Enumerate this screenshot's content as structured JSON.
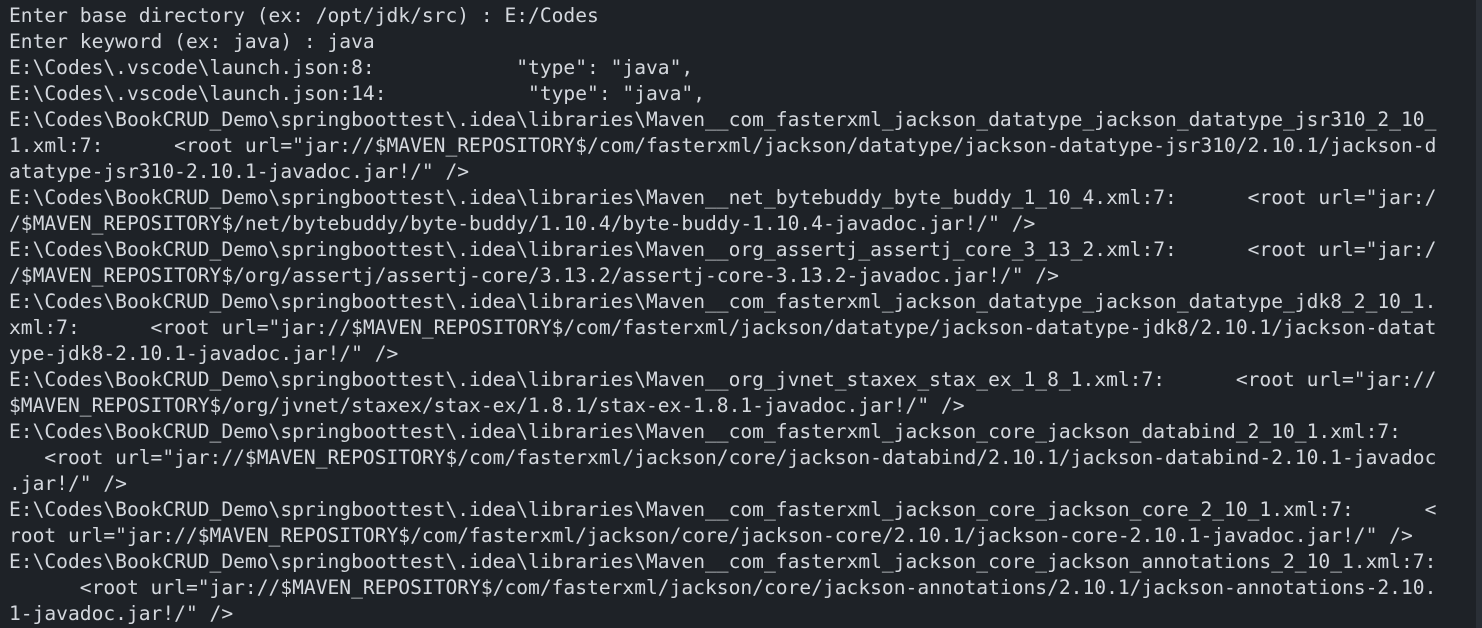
{
  "terminal": {
    "lines": [
      "Enter base directory (ex: /opt/jdk/src) : E:/Codes",
      "Enter keyword (ex: java) : java",
      "E:\\Codes\\.vscode\\launch.json:8:            \"type\": \"java\",",
      "E:\\Codes\\.vscode\\launch.json:14:            \"type\": \"java\",",
      "E:\\Codes\\BookCRUD_Demo\\springboottest\\.idea\\libraries\\Maven__com_fasterxml_jackson_datatype_jackson_datatype_jsr310_2_10_",
      "1.xml:7:      <root url=\"jar://$MAVEN_REPOSITORY$/com/fasterxml/jackson/datatype/jackson-datatype-jsr310/2.10.1/jackson-d",
      "atatype-jsr310-2.10.1-javadoc.jar!/\" />",
      "E:\\Codes\\BookCRUD_Demo\\springboottest\\.idea\\libraries\\Maven__net_bytebuddy_byte_buddy_1_10_4.xml:7:      <root url=\"jar:/",
      "/$MAVEN_REPOSITORY$/net/bytebuddy/byte-buddy/1.10.4/byte-buddy-1.10.4-javadoc.jar!/\" />",
      "E:\\Codes\\BookCRUD_Demo\\springboottest\\.idea\\libraries\\Maven__org_assertj_assertj_core_3_13_2.xml:7:      <root url=\"jar:/",
      "/$MAVEN_REPOSITORY$/org/assertj/assertj-core/3.13.2/assertj-core-3.13.2-javadoc.jar!/\" />",
      "E:\\Codes\\BookCRUD_Demo\\springboottest\\.idea\\libraries\\Maven__com_fasterxml_jackson_datatype_jackson_datatype_jdk8_2_10_1.",
      "xml:7:      <root url=\"jar://$MAVEN_REPOSITORY$/com/fasterxml/jackson/datatype/jackson-datatype-jdk8/2.10.1/jackson-datat",
      "ype-jdk8-2.10.1-javadoc.jar!/\" />",
      "E:\\Codes\\BookCRUD_Demo\\springboottest\\.idea\\libraries\\Maven__org_jvnet_staxex_stax_ex_1_8_1.xml:7:      <root url=\"jar://",
      "$MAVEN_REPOSITORY$/org/jvnet/staxex/stax-ex/1.8.1/stax-ex-1.8.1-javadoc.jar!/\" />",
      "E:\\Codes\\BookCRUD_Demo\\springboottest\\.idea\\libraries\\Maven__com_fasterxml_jackson_core_jackson_databind_2_10_1.xml:7:",
      "   <root url=\"jar://$MAVEN_REPOSITORY$/com/fasterxml/jackson/core/jackson-databind/2.10.1/jackson-databind-2.10.1-javadoc",
      ".jar!/\" />",
      "E:\\Codes\\BookCRUD_Demo\\springboottest\\.idea\\libraries\\Maven__com_fasterxml_jackson_core_jackson_core_2_10_1.xml:7:      <",
      "root url=\"jar://$MAVEN_REPOSITORY$/com/fasterxml/jackson/core/jackson-core/2.10.1/jackson-core-2.10.1-javadoc.jar!/\" />",
      "E:\\Codes\\BookCRUD_Demo\\springboottest\\.idea\\libraries\\Maven__com_fasterxml_jackson_core_jackson_annotations_2_10_1.xml:7:",
      "      <root url=\"jar://$MAVEN_REPOSITORY$/com/fasterxml/jackson/core/jackson-annotations/2.10.1/jackson-annotations-2.10.",
      "1-javadoc.jar!/\" />"
    ]
  },
  "colors": {
    "background": "#1e2227",
    "foreground": "#d4d8de"
  }
}
